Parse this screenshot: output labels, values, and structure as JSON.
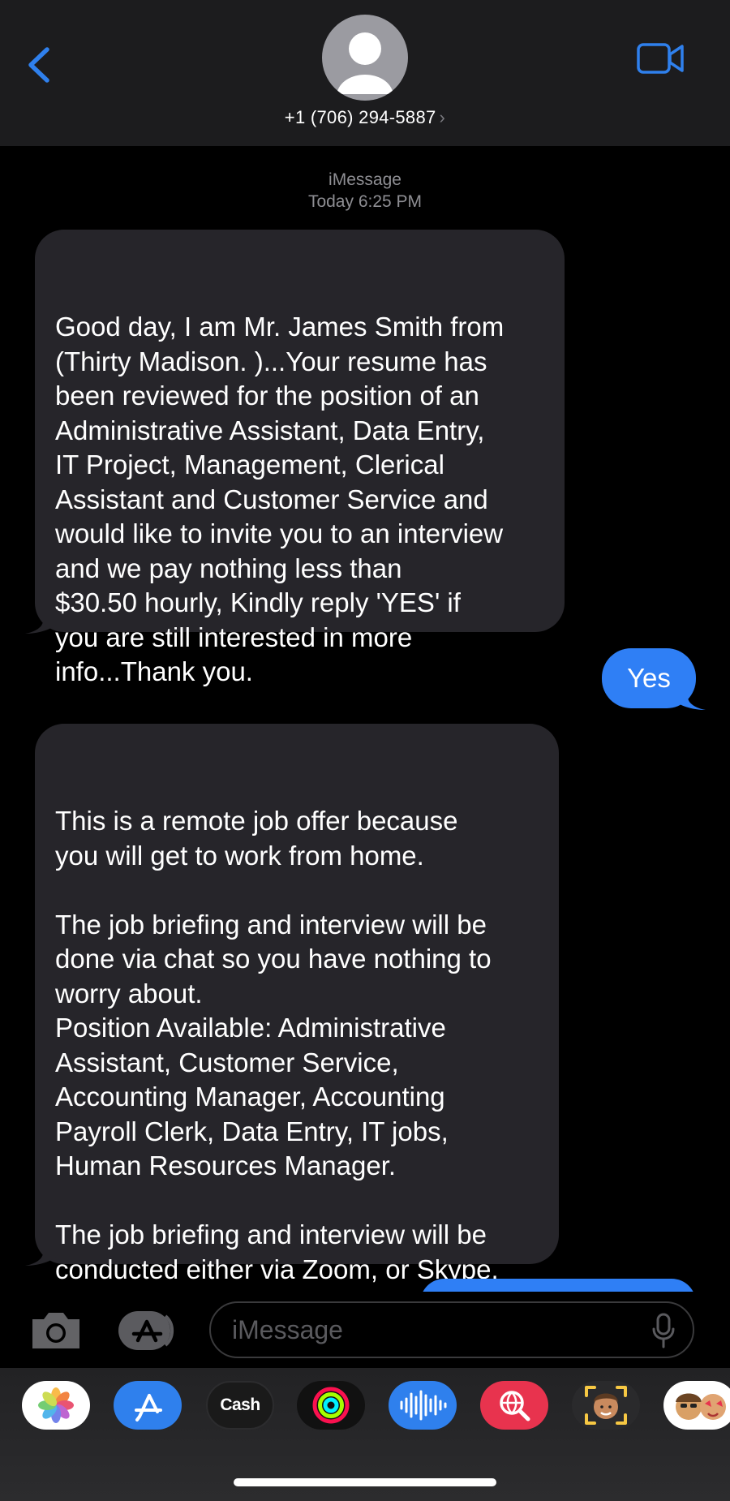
{
  "header": {
    "contact_number": "+1 (706) 294-5887",
    "chevron": "›",
    "icons": [
      "back-chevron-icon",
      "contact-avatar-icon",
      "video-camera-icon"
    ]
  },
  "conversation": {
    "service": "iMessage",
    "timestamp": "Today 6:25 PM",
    "messages": [
      {
        "direction": "incoming",
        "text": "Good day, I am Mr. James Smith from\n(Thirty Madison. )...Your resume has\nbeen reviewed for the position of an\nAdministrative Assistant, Data Entry,\nIT Project, Management, Clerical\nAssistant and Customer Service and\nwould like to invite you to an interview\nand we pay nothing less than\n$30.50 hourly, Kindly reply 'YES' if\nyou are still interested in more\ninfo...Thank you."
      },
      {
        "direction": "outgoing",
        "text": "Yes"
      },
      {
        "direction": "incoming",
        "text": "This is a remote job offer because\nyou will get to work from home.\n\nThe job briefing and interview will be\ndone via chat so you have nothing to\nworry about.\nPosition Available: Administrative\nAssistant, Customer Service,\nAccounting Manager, Accounting\nPayroll Clerk,  Data Entry, IT jobs,\nHuman Resources Manager.\n\nThe job briefing and interview will be\nconducted either via Zoom, or Skype.\nWhich of these do you have?"
      }
    ]
  },
  "input": {
    "placeholder": "iMessage",
    "icons": [
      "camera-icon",
      "app-store-icon",
      "microphone-icon"
    ]
  },
  "app_drawer": {
    "apps": [
      {
        "name": "photos-app-icon"
      },
      {
        "name": "app-store-app-icon"
      },
      {
        "name": "apple-cash-app-icon",
        "label": "Cash"
      },
      {
        "name": "activity-app-icon"
      },
      {
        "name": "audio-message-app-icon"
      },
      {
        "name": "images-search-app-icon"
      },
      {
        "name": "memoji-app-icon"
      },
      {
        "name": "memoji-stickers-app-icon"
      }
    ]
  },
  "colors": {
    "header_bg": "#1c1c1e",
    "incoming_bubble": "#26252a",
    "outgoing_bubble": "#2f7ff5",
    "accent_blue": "#2f80ed",
    "meta_text": "#8e8e93"
  }
}
